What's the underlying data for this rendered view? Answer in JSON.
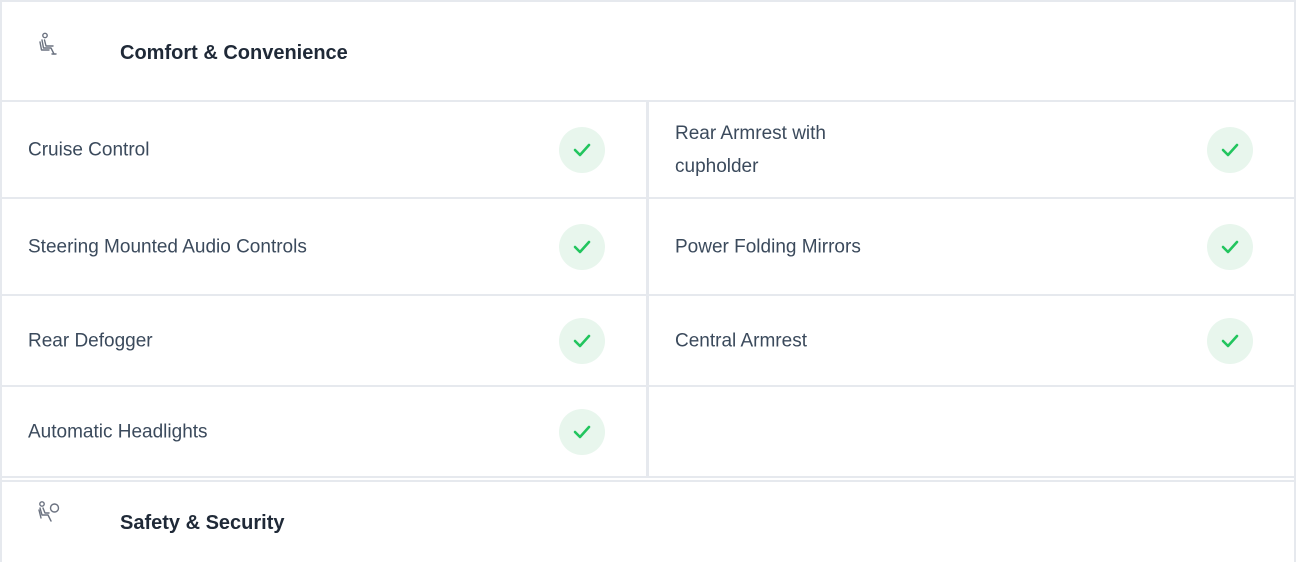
{
  "comfort": {
    "icon": "seat-icon",
    "title": "Comfort & Convenience",
    "features": [
      {
        "label": "Cruise Control",
        "available": true
      },
      {
        "label": "Rear Armrest with cupholder",
        "available": true
      },
      {
        "label": "Steering Mounted Audio Controls",
        "available": true
      },
      {
        "label": "Power Folding Mirrors",
        "available": true
      },
      {
        "label": "Rear Defogger",
        "available": true
      },
      {
        "label": "Central Armrest",
        "available": true
      },
      {
        "label": "Automatic Headlights",
        "available": true
      }
    ]
  },
  "safety": {
    "icon": "airbag-icon",
    "title": "Safety & Security"
  },
  "colors": {
    "check_green": "#22c55e",
    "check_bg": "#e8f6ed",
    "border": "#e6e9ee"
  }
}
